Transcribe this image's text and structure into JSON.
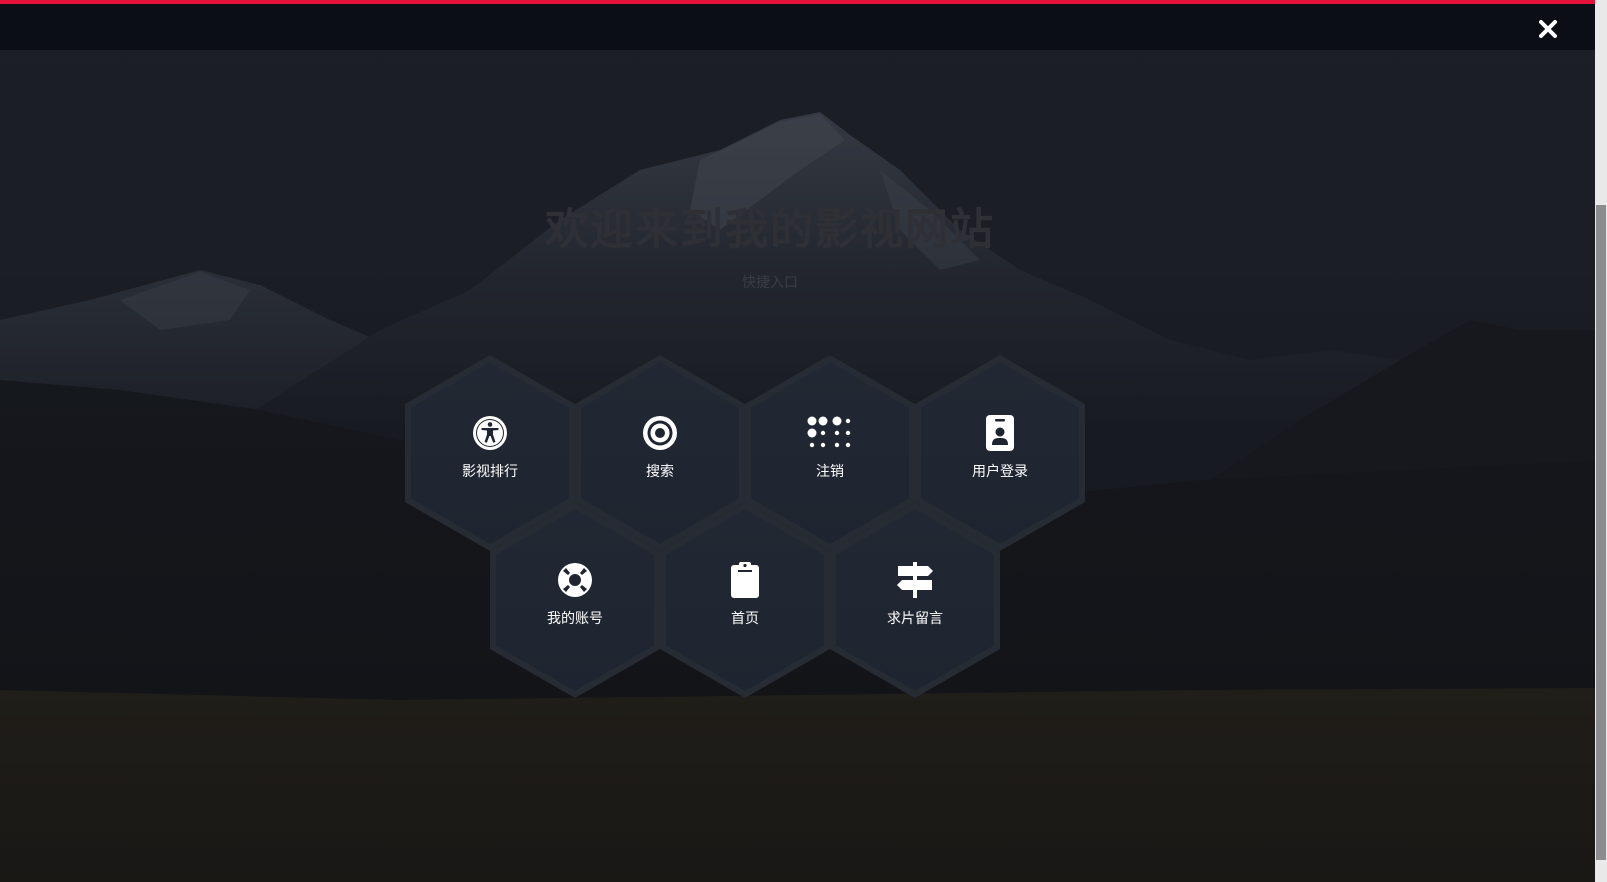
{
  "header": {
    "close_icon": "close-icon",
    "accent_color": "#e5133a",
    "bar_color": "#0b0e15"
  },
  "hero": {
    "title": "欢迎来到我的影视网站",
    "subtitle": "快捷入口"
  },
  "menu": {
    "items": [
      {
        "label": "影视排行",
        "icon": "accessibility-icon"
      },
      {
        "label": "搜索",
        "icon": "target-icon"
      },
      {
        "label": "注销",
        "icon": "braille-icon"
      },
      {
        "label": "用户登录",
        "icon": "id-badge-icon"
      },
      {
        "label": "我的账号",
        "icon": "life-ring-icon"
      },
      {
        "label": "首页",
        "icon": "clipboard-icon"
      },
      {
        "label": "求片留言",
        "icon": "signpost-icon"
      }
    ]
  }
}
